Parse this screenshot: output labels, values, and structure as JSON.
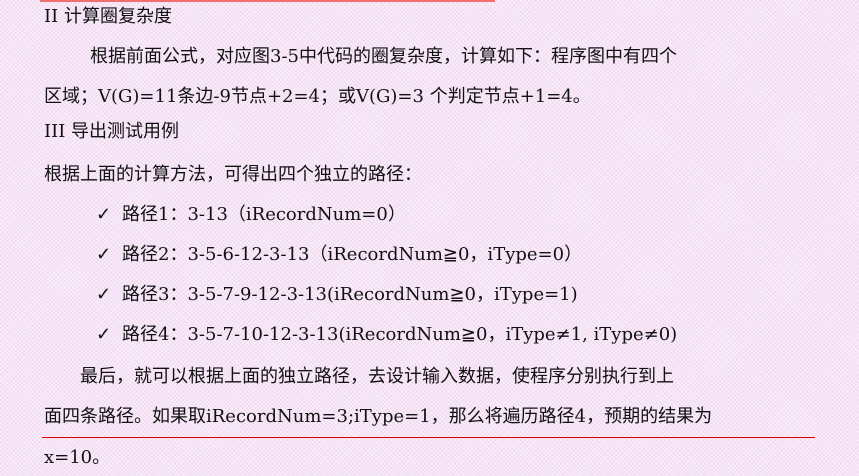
{
  "heading2": "II 计算圈复杂度",
  "para1_line1": "根据前面公式，对应图3-5中代码的圈复杂度，计算如下：程序图中有四个",
  "para1_line2": "区域；V(G)=11条边-9节点+2=4；或V(G)=3 个判定节点+1=4。",
  "heading3": "III 导出测试用例",
  "para2": "根据上面的计算方法，可得出四个独立的路径：",
  "check_icon": "✓",
  "paths": [
    "路径1：3-13（iRecordNum=0）",
    "路径2：3-5-6-12-3-13（iRecordNum≧0，iType=0）",
    "路径3：3-5-7-9-12-3-13(iRecordNum≧0，iType=1)",
    "路径4：3-5-7-10-12-3-13(iRecordNum≧0，iType≠1, iType≠0)"
  ],
  "para3_line1": "最后，就可以根据上面的独立路径，去设计输入数据，使程序分别执行到上",
  "para3_line2": "面四条路径。如果取iRecordNum=3;iType=1，那么将遍历路径4，预期的结果为",
  "para3_line3": "x=10。",
  "colors": {
    "background": "#fbeefb",
    "top_bar": "#f07070",
    "red_line": "#e00000"
  }
}
